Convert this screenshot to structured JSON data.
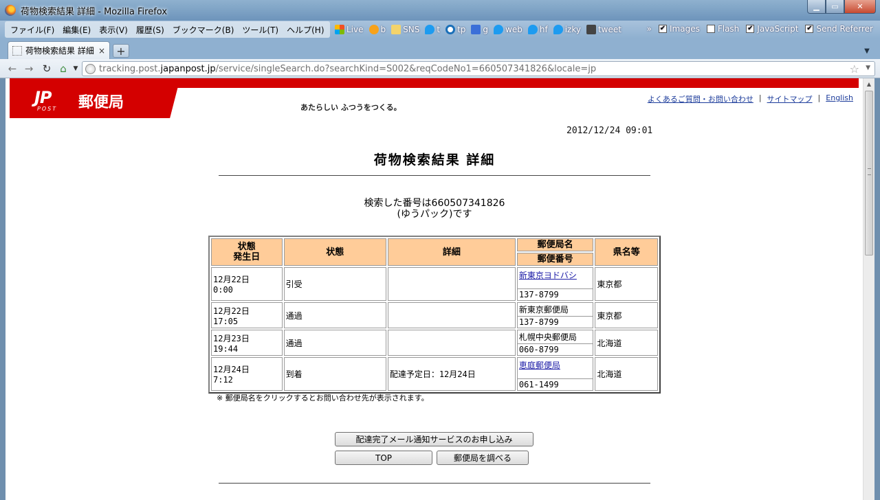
{
  "window": {
    "title": "荷物検索結果 詳細 - Mozilla Firefox"
  },
  "menubar": {
    "items": [
      "ファイル(F)",
      "編集(E)",
      "表示(V)",
      "履歴(S)",
      "ブックマーク(B)",
      "ツール(T)",
      "ヘルプ(H)"
    ]
  },
  "bookmarks": [
    {
      "label": "Live",
      "icon": "windows-live-icon"
    },
    {
      "label": "b",
      "icon": "hatena-icon"
    },
    {
      "label": "SNS",
      "icon": "folder-icon"
    },
    {
      "label": "t",
      "icon": "twitter-icon"
    },
    {
      "label": "tp",
      "icon": "twitpic-icon"
    },
    {
      "label": "g",
      "icon": "google-icon"
    },
    {
      "label": "web",
      "icon": "twitter-icon"
    },
    {
      "label": "hf",
      "icon": "twitter-icon"
    },
    {
      "label": "izky",
      "icon": "twitter-icon"
    },
    {
      "label": "tweet",
      "icon": "tweet-icon"
    }
  ],
  "prefs": {
    "overflow": "»",
    "items": [
      {
        "label": "Images",
        "checked": true
      },
      {
        "label": "Flash",
        "checked": false
      },
      {
        "label": "JavaScript",
        "checked": true
      },
      {
        "label": "Send Referrer",
        "checked": true
      }
    ]
  },
  "tab": {
    "title": "荷物検索結果 詳細",
    "close": "×",
    "new": "+"
  },
  "address": {
    "prefix": "tracking.post.",
    "domain": "japanpost.jp",
    "path": "/service/singleSearch.do?searchKind=S002&reqCodeNo1=660507341826&locale=jp"
  },
  "header": {
    "logo_mark": "JP",
    "logo_post": "POST",
    "logo_name": "郵便局",
    "tagline": "あたらしい ふつうをつくる。",
    "links": [
      "よくあるご質問・お問い合わせ",
      "サイトマップ",
      "English"
    ],
    "separator": "|"
  },
  "page": {
    "timestamp": "2012/12/24 09:01",
    "title": "荷物検索結果 詳細",
    "searched_line1": "検索した番号は660507341826",
    "searched_line2": "(ゆうパック)です",
    "note": "※ 郵便局名をクリックするとお問い合わせ先が表示されます。"
  },
  "table": {
    "headers": {
      "date_line1": "状態",
      "date_line2": "発生日",
      "status": "状態",
      "detail": "詳細",
      "office_name": "郵便局名",
      "postal_code": "郵便番号",
      "prefecture": "県名等"
    },
    "rows": [
      {
        "date": "12月22日",
        "time": "0:00",
        "status": "引受",
        "detail": "",
        "office": "新東京ヨドバシ",
        "office_link": true,
        "zip": "137-8799",
        "pref": "東京都"
      },
      {
        "date": "12月22日",
        "time": "17:05",
        "status": "通過",
        "detail": "",
        "office": "新東京郵便局",
        "office_link": false,
        "zip": "137-8799",
        "pref": "東京都"
      },
      {
        "date": "12月23日",
        "time": "19:44",
        "status": "通過",
        "detail": "",
        "office": "札幌中央郵便局",
        "office_link": false,
        "zip": "060-8799",
        "pref": "北海道"
      },
      {
        "date": "12月24日",
        "time": "7:12",
        "status": "到着",
        "detail": "配達予定日：12月24日",
        "office": "恵庭郵便局",
        "office_link": true,
        "zip": "061-1499",
        "pref": "北海道"
      }
    ]
  },
  "buttons": {
    "notify": "配達完了メール通知サービスのお申し込み",
    "top": "TOP",
    "find_office": "郵便局を調べる"
  },
  "colors": {
    "brand_red": "#d40000",
    "header_orange": "#ffcc99",
    "link_blue": "#1a1aa6"
  }
}
